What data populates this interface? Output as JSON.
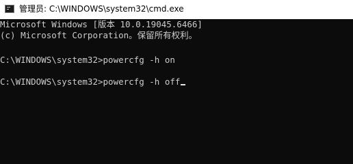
{
  "window": {
    "title": "管理员: C:\\WINDOWS\\system32\\cmd.exe",
    "icon": "cmd-app-icon"
  },
  "console": {
    "lines": [
      "Microsoft Windows [版本 10.0.19045.6466]",
      "(c) Microsoft Corporation。保留所有权利。",
      "",
      "C:\\WINDOWS\\system32>powercfg -h on",
      "",
      "C:\\WINDOWS\\system32>powercfg -h off"
    ]
  },
  "colors": {
    "console_bg": "#0c0c0c",
    "console_fg": "#cccccc",
    "titlebar_bg": "#ffffff"
  }
}
